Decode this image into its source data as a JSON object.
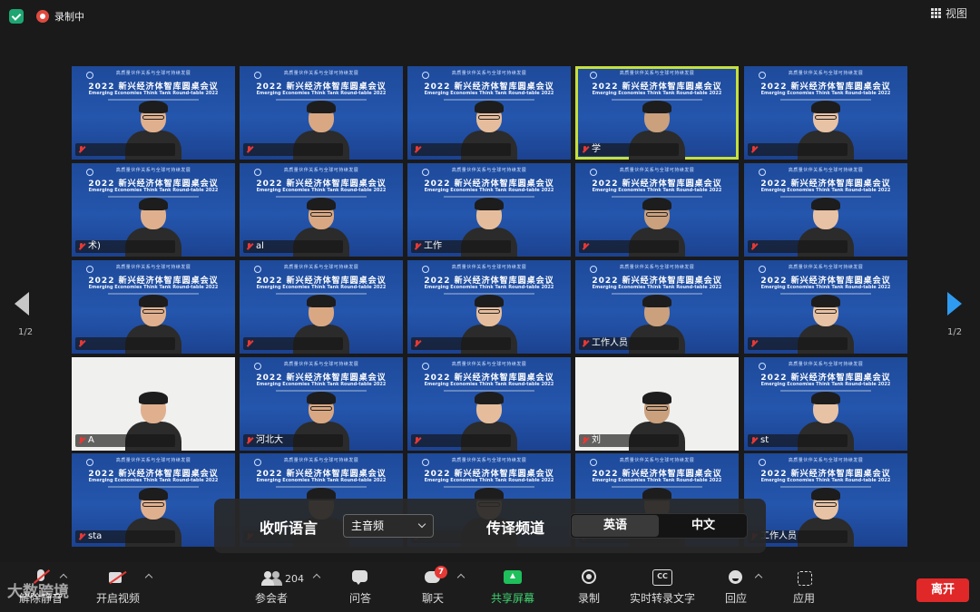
{
  "topbar": {
    "recording_label": "录制中",
    "view_label": "视图"
  },
  "pagination": {
    "left": "1/2",
    "right": "1/2"
  },
  "banner": {
    "top_line": "高质量伙伴关系与全球可持续发展",
    "title_cn": "2022 新兴经济体智库圆桌会议",
    "title_en": "Emerging Economies Think Tank Round-table 2022"
  },
  "tiles": [
    {
      "name": "",
      "type": "banner",
      "row": 0,
      "col": 0
    },
    {
      "name": "",
      "type": "banner",
      "row": 0,
      "col": 1
    },
    {
      "name": "",
      "type": "banner",
      "row": 0,
      "col": 2
    },
    {
      "name": "学",
      "type": "banner",
      "row": 0,
      "col": 3,
      "active": true
    },
    {
      "name": "",
      "type": "banner",
      "row": 0,
      "col": 4
    },
    {
      "name": "术)",
      "type": "banner",
      "row": 1,
      "col": 0
    },
    {
      "name": "al",
      "type": "banner",
      "row": 1,
      "col": 1
    },
    {
      "name": "工作",
      "type": "banner",
      "row": 1,
      "col": 2
    },
    {
      "name": "",
      "type": "banner",
      "row": 1,
      "col": 3
    },
    {
      "name": "",
      "type": "banner",
      "row": 1,
      "col": 4
    },
    {
      "name": "",
      "type": "banner",
      "row": 2,
      "col": 0
    },
    {
      "name": "",
      "type": "banner",
      "row": 2,
      "col": 1
    },
    {
      "name": "",
      "type": "banner",
      "row": 2,
      "col": 2
    },
    {
      "name": "工作人员",
      "type": "banner",
      "row": 2,
      "col": 3
    },
    {
      "name": "",
      "type": "banner",
      "row": 2,
      "col": 4
    },
    {
      "name": "A",
      "type": "white",
      "row": 3,
      "col": 0
    },
    {
      "name": "河北大",
      "type": "banner",
      "row": 3,
      "col": 1
    },
    {
      "name": "",
      "type": "banner",
      "row": 3,
      "col": 2
    },
    {
      "name": "刘",
      "type": "white",
      "row": 3,
      "col": 3
    },
    {
      "name": "st",
      "type": "banner",
      "row": 3,
      "col": 4
    },
    {
      "name": "sta",
      "type": "banner",
      "row": 4,
      "col": 0
    },
    {
      "name": "",
      "type": "banner",
      "row": 4,
      "col": 1
    },
    {
      "name": "",
      "type": "banner",
      "row": 4,
      "col": 2
    },
    {
      "name": "",
      "type": "banner",
      "row": 4,
      "col": 3
    },
    {
      "name": "工作人员",
      "type": "banner",
      "row": 4,
      "col": 4
    }
  ],
  "interpretation": {
    "listen_label": "收听语言",
    "listen_value": "主音频",
    "channel_label": "传译频道",
    "options": [
      "英语",
      "中文"
    ],
    "selected": "英语"
  },
  "toolbar": {
    "mute": "解除静音",
    "video": "开启视频",
    "participants": "参会者",
    "participants_count": "204",
    "qa": "问答",
    "chat": "聊天",
    "chat_badge": "7",
    "share": "共享屏幕",
    "record": "录制",
    "captions": "实时转录文字",
    "cc_text": "CC",
    "reactions": "回应",
    "apps": "应用",
    "leave": "离开"
  },
  "watermark": "大数跨境"
}
